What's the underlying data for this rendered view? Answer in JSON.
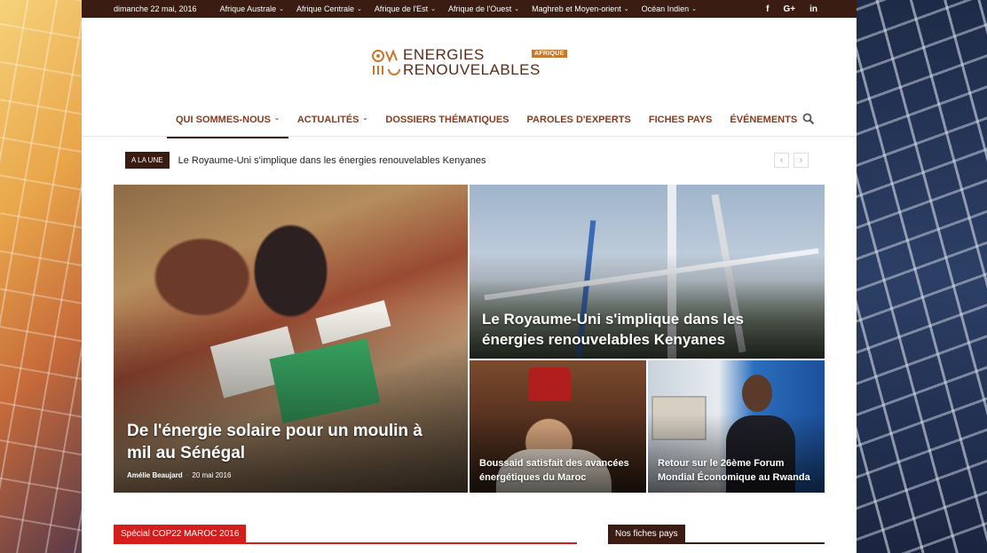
{
  "topbar": {
    "date": "dimanche 22 mai, 2016",
    "regions": [
      "Afrique Australe",
      "Afrique Centrale",
      "Afrique de l'Est",
      "Afrique de l'Ouest",
      "Maghreb et Moyen-orient",
      "Océan Indien"
    ],
    "social": [
      "f",
      "G+",
      "in"
    ]
  },
  "logo": {
    "line1": "ENERGIES",
    "line2": "RENOUVELABLES",
    "badge": "AFRIQUE"
  },
  "nav": {
    "items": [
      "QUI SOMMES-NOUS",
      "ACTUALITÉS",
      "DOSSIERS THÉMATIQUES",
      "PAROLES D'EXPERTS",
      "FICHES PAYS",
      "ÉVÉNEMENTS"
    ]
  },
  "ticker": {
    "label": "A LA UNE",
    "headline": "Le Royaume-Uni s'implique dans les énergies renouvelables Kenyanes",
    "prev": "‹",
    "next": "›"
  },
  "featured": {
    "main": {
      "title": "De l'énergie solaire pour un moulin à mil au Sénégal",
      "author": "Amélie Beaujard",
      "date": "20 mai 2016"
    },
    "top_right": {
      "title": "Le Royaume-Uni s'implique dans les énergies renouvelables Kenyanes"
    },
    "bottom_left": {
      "title": "Boussaid satisfait des avancées énergétiques du Maroc"
    },
    "bottom_right": {
      "title": "Retour sur le 26ème Forum Mondial Économique au Rwanda"
    }
  },
  "blocks": {
    "left_title": "Spécial COP22 MAROC 2016",
    "right_title": "Nos fiches pays"
  },
  "colors": {
    "brown": "#3a1c12",
    "nav_text": "#8a3a1c",
    "accent_red": "#d41e1e",
    "badge": "#c8772e"
  }
}
